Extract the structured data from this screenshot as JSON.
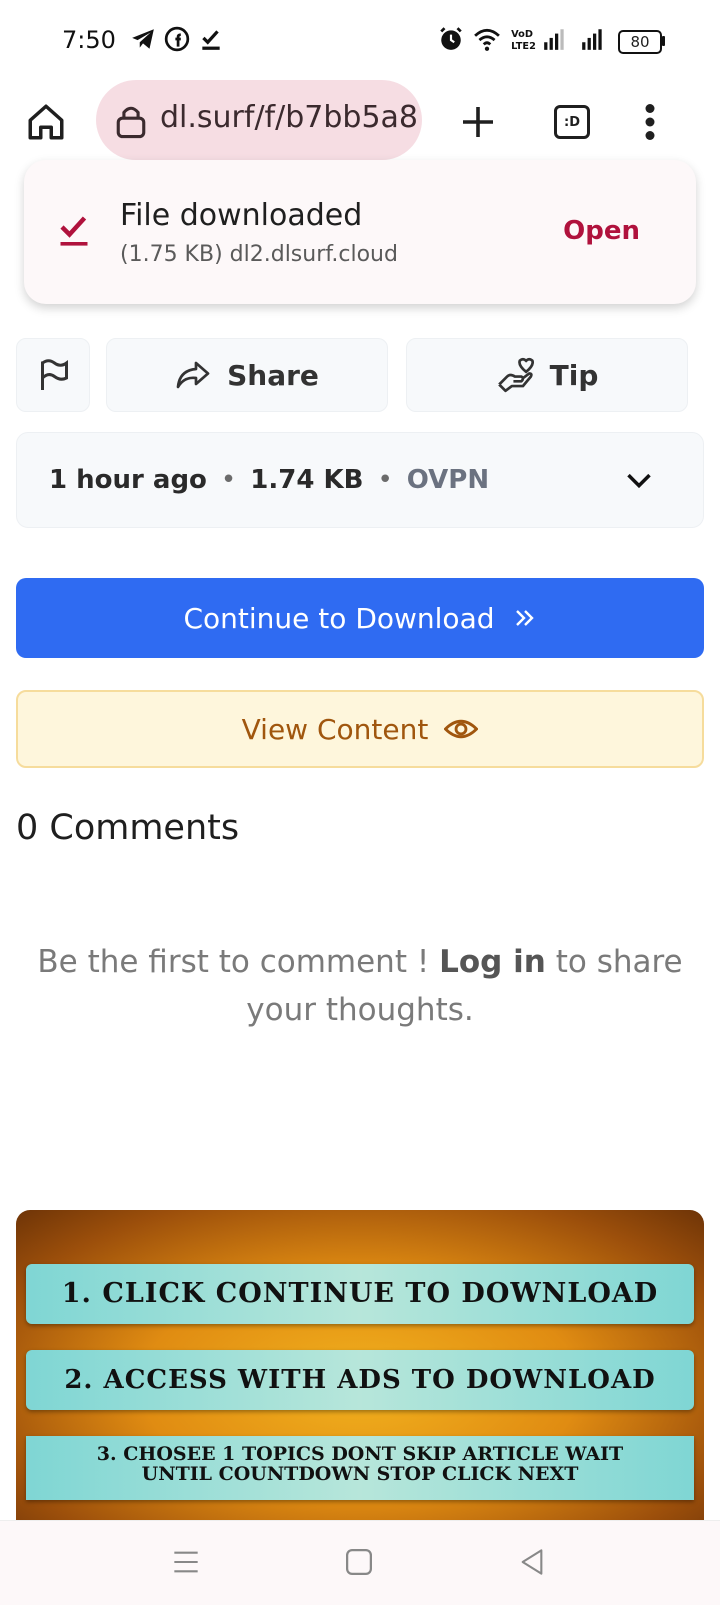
{
  "status_bar": {
    "time": "7:50",
    "battery": "80",
    "icons": [
      "telegram-icon",
      "facebook-icon",
      "check-icon",
      "alarm-icon",
      "wifi-icon",
      "volte-icon",
      "signal-icon",
      "signal-icon",
      "battery-icon"
    ]
  },
  "browser": {
    "url": "dl.surf/f/b7bb5a8",
    "tab_count_label": ":D"
  },
  "download_toast": {
    "title": "File downloaded",
    "subtitle": "(1.75 KB) dl2.dlsurf.cloud",
    "open_label": "Open"
  },
  "actions": {
    "share_label": "Share",
    "tip_label": "Tip"
  },
  "file_info": {
    "time_ago": "1 hour ago",
    "size": "1.74 KB",
    "category": "OVPN"
  },
  "buttons": {
    "continue_label": "Continue to Download",
    "view_label": "View Content"
  },
  "comments": {
    "heading": "0 Comments",
    "empty_prefix": "Be the first to comment ! ",
    "login_label": "Log in",
    "empty_suffix": " to share your thoughts."
  },
  "promo": {
    "step1": "1. Click Continue to Download",
    "step2": "2. Access with ads to Download",
    "step3_line1": "3. chosee 1 topics dont skip article wait",
    "step3_line2": "until countdown stop click next"
  },
  "colors": {
    "primary": "#2f6bf2",
    "accent_open": "#b0123d",
    "view_text": "#a0560e"
  }
}
